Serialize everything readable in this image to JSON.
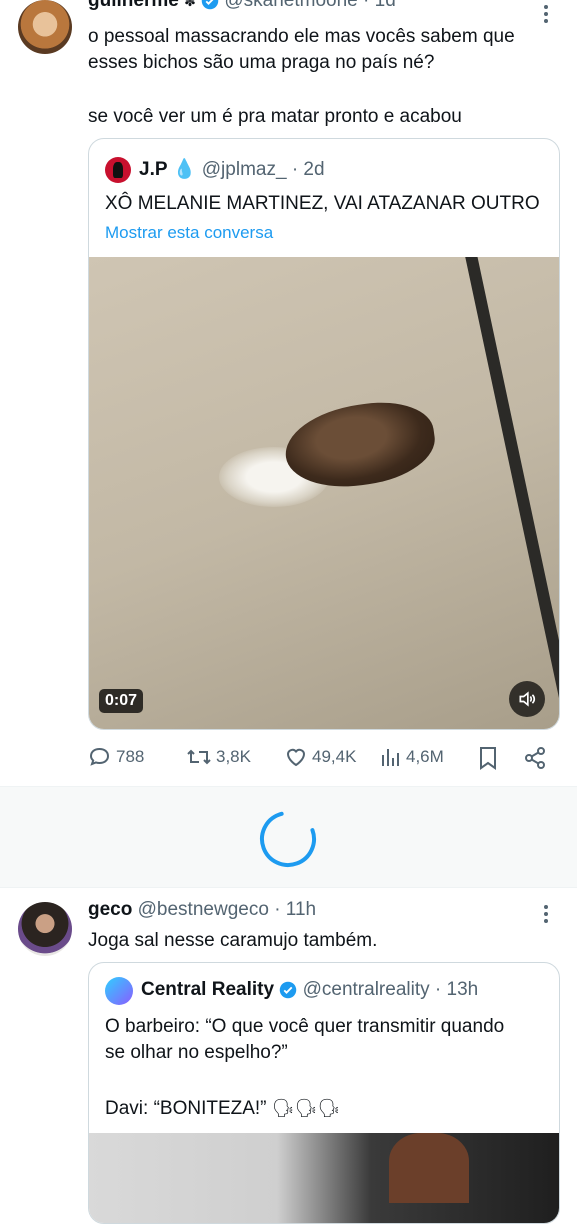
{
  "tweet1": {
    "name": "guilherme",
    "handle": "@skarletmoone",
    "time": "· 1d",
    "text_line1": "o pessoal massacrando ele mas vocês sabem que",
    "text_line2": "esses bichos são uma praga no país né?",
    "text_line3": "se você ver um é pra matar pronto e acabou",
    "quote": {
      "name": "J.P",
      "handle": "@jplmaz_",
      "time": "· 2d",
      "text": "XÔ MELANIE MARTINEZ, VAI ATAZANAR OUTRO",
      "show_thread": "Mostrar esta conversa",
      "video_time": "0:07"
    },
    "stats": {
      "replies": "788",
      "retweets": "3,8K",
      "likes": "49,4K",
      "views": "4,6M"
    }
  },
  "tweet2": {
    "name": "geco",
    "handle": "@bestnewgeco",
    "time": "· 11h",
    "text": "Joga sal nesse caramujo também.",
    "quote": {
      "name": "Central Reality",
      "handle": "@centralreality",
      "time": "· 13h",
      "line1": "O barbeiro: “O que você quer transmitir quando",
      "line2": "se olhar no espelho?”",
      "line3": "Davi: “BONITEZA!”"
    }
  },
  "colors": {
    "accent": "#1d9bf0",
    "muted": "#536471",
    "border": "#cfd9de",
    "link": "#1d9bf0",
    "divider_bg": "#f7f9f9"
  }
}
